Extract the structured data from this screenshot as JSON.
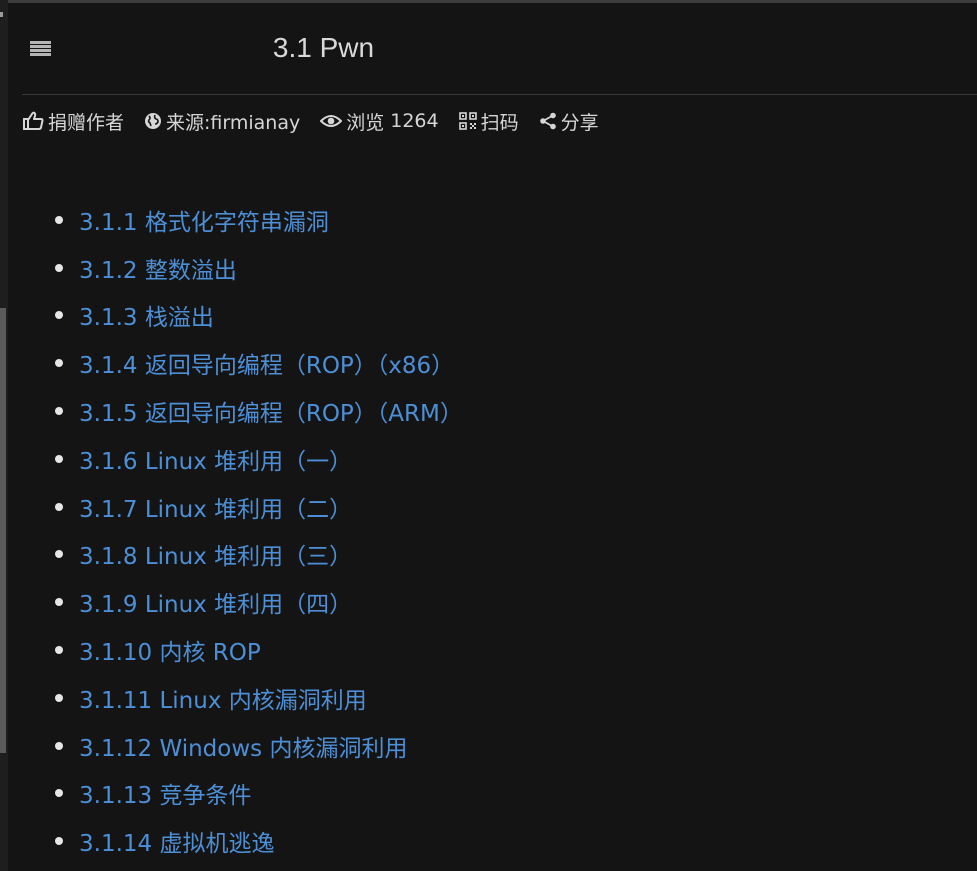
{
  "header": {
    "title": "3.1 Pwn"
  },
  "meta": {
    "donate": "捐赠作者",
    "source": "来源:firmianay",
    "views_label": "浏览",
    "views_count": "1264",
    "qrcode": "扫码",
    "share": "分享"
  },
  "toc": {
    "items": [
      {
        "label": "3.1.1 格式化字符串漏洞"
      },
      {
        "label": "3.1.2 整数溢出"
      },
      {
        "label": "3.1.3 栈溢出"
      },
      {
        "label": "3.1.4 返回导向编程（ROP）（x86）"
      },
      {
        "label": "3.1.5 返回导向编程（ROP）（ARM）"
      },
      {
        "label": "3.1.6 Linux 堆利用（一）"
      },
      {
        "label": "3.1.7 Linux 堆利用（二）"
      },
      {
        "label": "3.1.8 Linux 堆利用（三）"
      },
      {
        "label": "3.1.9 Linux 堆利用（四）"
      },
      {
        "label": "3.1.10 内核 ROP"
      },
      {
        "label": "3.1.11 Linux 内核漏洞利用"
      },
      {
        "label": "3.1.12 Windows 内核漏洞利用"
      },
      {
        "label": "3.1.13 竞争条件"
      },
      {
        "label": "3.1.14 虚拟机逃逸"
      }
    ]
  },
  "colors": {
    "background": "#141414",
    "link": "#4d8fd6",
    "text": "#d6d6d6"
  },
  "icons": {
    "menu": "hamburger-icon",
    "donate": "thumbs-up-icon",
    "source": "globe-icon",
    "views": "eye-icon",
    "qrcode": "qrcode-icon",
    "share": "share-icon"
  }
}
